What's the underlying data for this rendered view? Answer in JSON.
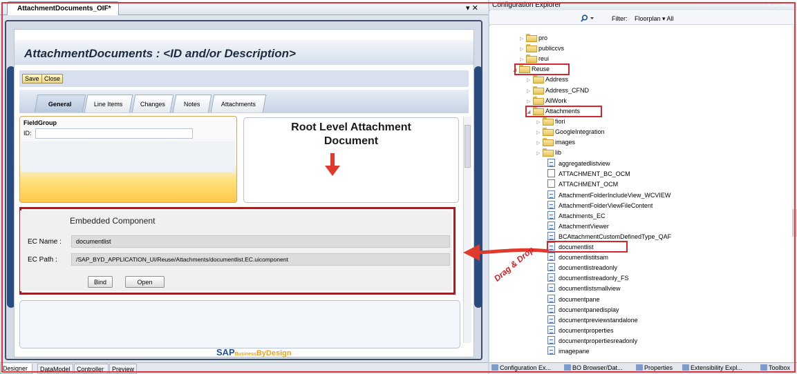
{
  "designer": {
    "doc_tab": "AttachmentDocuments_OIF*",
    "doc_tab_tools": "▾ ✕",
    "title": "AttachmentDocuments : <ID and/or Description>",
    "buttons": {
      "save": "Save",
      "close": "Close"
    },
    "tabs": [
      "General",
      "Line Items",
      "Changes",
      "Notes",
      "Attachments"
    ],
    "active_tab": "General",
    "fieldgroup": {
      "title": "FieldGroup",
      "id_label": "ID:",
      "id_value": ""
    },
    "annotation": {
      "root_label": "Root Level Attachment Document"
    },
    "embedded": {
      "title": "Embedded Component",
      "name_label": "EC Name :",
      "name_value": "documentlist",
      "path_label": "EC Path :",
      "path_value": "/SAP_BYD_APPLICATION_UI/Reuse/Attachments/documentlist.EC.uicomponent",
      "bind_label": "Bind",
      "open_label": "Open"
    },
    "logo": {
      "sap": "SAP",
      "business": "Business",
      "bydesign": "ByDesign"
    },
    "bottom_tabs": [
      "Designer",
      "DataModel",
      "Controller",
      "Preview"
    ],
    "active_bottom_tab": "Designer"
  },
  "explorer": {
    "title": "Configuration Explorer",
    "filter_label": "Filter:",
    "filter_value": "Floorplan  ▾ All",
    "tree": [
      {
        "label": "pro",
        "type": "folder",
        "expander": "▷"
      },
      {
        "label": "publiccvs",
        "type": "folder",
        "expander": "▷"
      },
      {
        "label": "reui",
        "type": "folder",
        "expander": "▷"
      },
      {
        "label": "Reuse",
        "type": "folder",
        "expander": "◢"
      },
      {
        "label": "Address",
        "type": "folder",
        "expander": "▷"
      },
      {
        "label": "Address_CFND",
        "type": "folder",
        "expander": "▷"
      },
      {
        "label": "AllWork",
        "type": "folder",
        "expander": "▷"
      },
      {
        "label": "Attachments",
        "type": "folder",
        "expander": "◢"
      },
      {
        "label": "fiori",
        "type": "folder",
        "expander": "▷"
      },
      {
        "label": "GoogleIntegration",
        "type": "folder",
        "expander": "▷"
      },
      {
        "label": "images",
        "type": "folder",
        "expander": "▷"
      },
      {
        "label": "lib",
        "type": "folder",
        "expander": "▷"
      },
      {
        "label": "aggregatedlistview",
        "type": "doc"
      },
      {
        "label": "ATTACHMENT_BC_OCM",
        "type": "plain"
      },
      {
        "label": "ATTACHMENT_OCM",
        "type": "plain"
      },
      {
        "label": "AttachmentFolderIncludeView_WCVIEW",
        "type": "doc"
      },
      {
        "label": "AttachmentFolderViewFileContent",
        "type": "doc"
      },
      {
        "label": "Attachments_EC",
        "type": "doc"
      },
      {
        "label": "AttachmentViewer",
        "type": "doc"
      },
      {
        "label": "BCAttachmentCustomDefinedType_QAF",
        "type": "doc"
      },
      {
        "label": "documentlist",
        "type": "doc"
      },
      {
        "label": "documentlistitsam",
        "type": "doc"
      },
      {
        "label": "documentlistreadonly",
        "type": "doc"
      },
      {
        "label": "documentlistreadonly_FS",
        "type": "doc"
      },
      {
        "label": "documentlistsmallview",
        "type": "doc"
      },
      {
        "label": "documentpane",
        "type": "doc"
      },
      {
        "label": "documentpanedisplay",
        "type": "doc"
      },
      {
        "label": "documentpreviewstandalone",
        "type": "doc"
      },
      {
        "label": "documentproperties",
        "type": "doc"
      },
      {
        "label": "documentpropertiesreadonly",
        "type": "doc"
      },
      {
        "label": "imagepane",
        "type": "doc"
      }
    ],
    "bottom_tabs": [
      "Configuration Ex...",
      "BO Browser/Dat...",
      "Properties",
      "Extensibility Expl...",
      "Toolbox"
    ]
  },
  "annotation": {
    "drag_label": "Drag & Drop"
  },
  "colors": {
    "highlight": "#d2262c",
    "sap_blue": "#1f4f9c",
    "side_bar": "#2b4a7e"
  }
}
